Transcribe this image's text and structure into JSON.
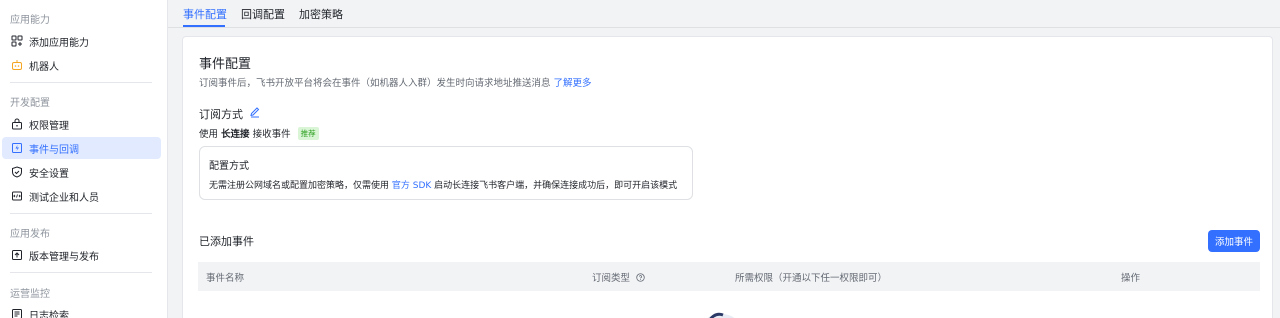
{
  "sidebar": {
    "groups": [
      {
        "title": "应用能力",
        "items": [
          {
            "label": "添加应用能力",
            "icon": "grid-plus-icon"
          },
          {
            "label": "机器人",
            "icon": "robot-icon"
          }
        ]
      },
      {
        "title": "开发配置",
        "items": [
          {
            "label": "权限管理",
            "icon": "permission-icon"
          },
          {
            "label": "事件与回调",
            "icon": "event-icon",
            "active": true
          },
          {
            "label": "安全设置",
            "icon": "shield-icon"
          },
          {
            "label": "测试企业和人员",
            "icon": "test-icon"
          }
        ]
      },
      {
        "title": "应用发布",
        "items": [
          {
            "label": "版本管理与发布",
            "icon": "upload-icon"
          }
        ]
      },
      {
        "title": "运营监控",
        "items": [
          {
            "label": "日志检索",
            "icon": "log-icon"
          }
        ]
      }
    ]
  },
  "tabs": [
    {
      "label": "事件配置",
      "active": true
    },
    {
      "label": "回调配置"
    },
    {
      "label": "加密策略"
    }
  ],
  "main": {
    "title": "事件配置",
    "description": "订阅事件后，飞书开放平台将会在事件（如机器人入群）发生时向请求地址推送消息",
    "learn_more": "了解更多",
    "subscription": {
      "title": "订阅方式",
      "prefix": "使用",
      "mode": "长连接",
      "suffix": "接收事件",
      "badge": "推荐"
    },
    "config_box": {
      "title": "配置方式",
      "text_before": "无需注册公网域名或配置加密策略，仅需使用",
      "sdk_link": "官方 SDK",
      "text_after": "启动长连接飞书客户端，并确保连接成功后，即可开启该模式"
    },
    "added_events": {
      "title": "已添加事件",
      "add_button": "添加事件",
      "columns": [
        "事件名称",
        "订阅类型",
        "所需权限（开通以下任一权限即可）",
        "操作"
      ]
    }
  },
  "colors": {
    "accent": "#3370ff",
    "active_bg": "#e1eaff",
    "badge_text": "#2ea121",
    "badge_bg": "#d9f5d6"
  }
}
